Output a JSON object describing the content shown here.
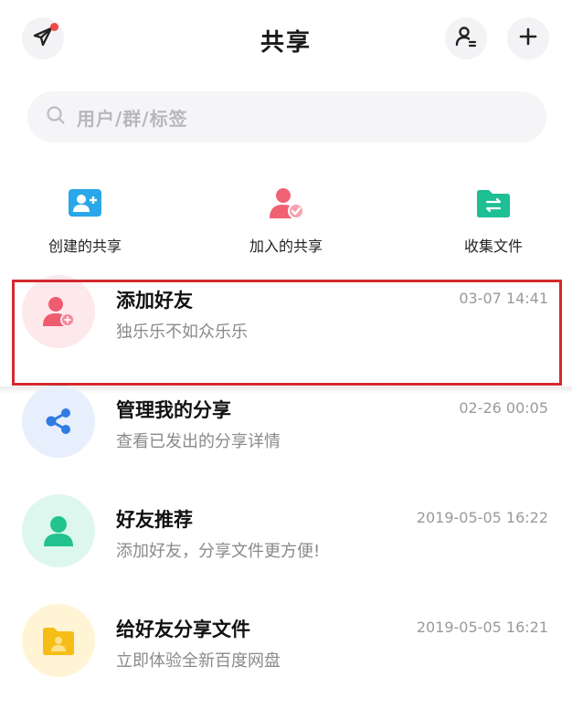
{
  "header": {
    "title": "共享",
    "send_icon": "paper-plane-icon",
    "contacts_icon": "contacts-icon",
    "add_icon": "plus-icon"
  },
  "search": {
    "placeholder": "用户/群/标签"
  },
  "quick_actions": [
    {
      "label": "创建的共享",
      "icon": "create-share-icon",
      "color": "#2aa7e8"
    },
    {
      "label": "加入的共享",
      "icon": "joined-share-icon",
      "color": "#f06273"
    },
    {
      "label": "收集文件",
      "icon": "collect-folder-icon",
      "color": "#1dbf94"
    }
  ],
  "list": [
    {
      "title": "添加好友",
      "subtitle": "独乐乐不如众乐乐",
      "time": "03-07 14:41",
      "icon": "add-friend-icon",
      "avatar_bg": "#fde8ec",
      "icon_color": "#ee5c70"
    },
    {
      "title": "管理我的分享",
      "subtitle": "查看已发出的分享详情",
      "time": "02-26 00:05",
      "icon": "share-icon",
      "avatar_bg": "#e7effc",
      "icon_color": "#2f7be4"
    },
    {
      "title": "好友推荐",
      "subtitle": "添加好友，分享文件更方便!",
      "time": "2019-05-05 16:22",
      "icon": "person-icon",
      "avatar_bg": "#ddf7ee",
      "icon_color": "#22c38e"
    },
    {
      "title": "给好友分享文件",
      "subtitle": "立即体验全新百度网盘",
      "time": "2019-05-05 16:21",
      "icon": "folder-icon",
      "avatar_bg": "#fff4d4",
      "icon_color": "#f6bd16"
    }
  ]
}
